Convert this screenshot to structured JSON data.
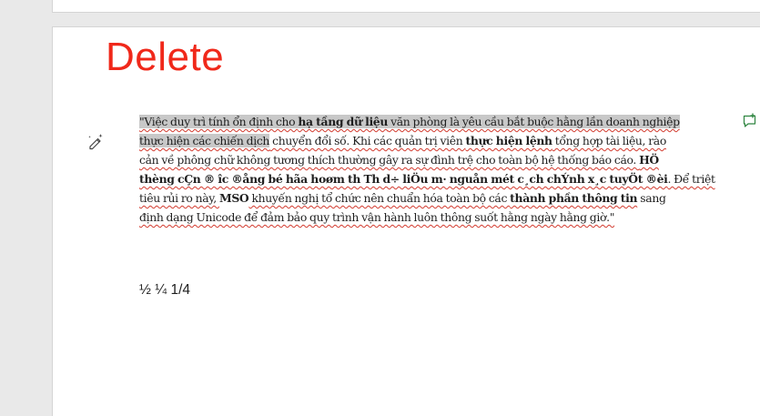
{
  "document": {
    "heading": "Delete",
    "paragraph": {
      "line1": {
        "a": "\"Việc duy trì tính ổn định cho ",
        "b": "hạ tầng dữ liệu",
        "c": " văn phòng là yêu cầu bắt buộc hằng lần doanh nghiệp"
      },
      "line2": {
        "a": "thực hiện các chiến dịch",
        "b": " chuyển đổi số. Khi các quản trị viên ",
        "c": "thực hiện lệnh",
        "d": " tổng hợp tài liệu, rào"
      },
      "line3": {
        "a": "cản về phông chữ không tương thích thường gây ra sự đình trệ cho toàn bộ hệ thống báo cáo. ",
        "b": "HÖ"
      },
      "line4": {
        "a": "thèng cÇn ® îc ®ång bé hãa hoøm th Th d÷ liÖu m· nguån mét c¸ch chÝnh x¸c tuyÖt ®èi",
        "b": ". Để triệt"
      },
      "line5": {
        "a": "tiêu rủi ro này, ",
        "b": "MSO",
        "c": " khuyến nghị tổ chức nên chuẩn hóa toàn bộ các ",
        "d": "thành phần thông tin",
        "e": " sang"
      },
      "line6": {
        "a": "định dạng Unicode để đảm bảo quy trình vận hành luôn thông suốt hằng ngày hằng giờ.\""
      }
    },
    "fractions": "½ ¼ 1/4"
  },
  "icons": {
    "rewrite": "magic-pen-icon",
    "comment": "new-comment-icon"
  },
  "colors": {
    "heading": "#f0281a",
    "selection": "#c8c8c8",
    "spellcheck": "#d23a2e",
    "comment_icon": "#2e8540"
  }
}
